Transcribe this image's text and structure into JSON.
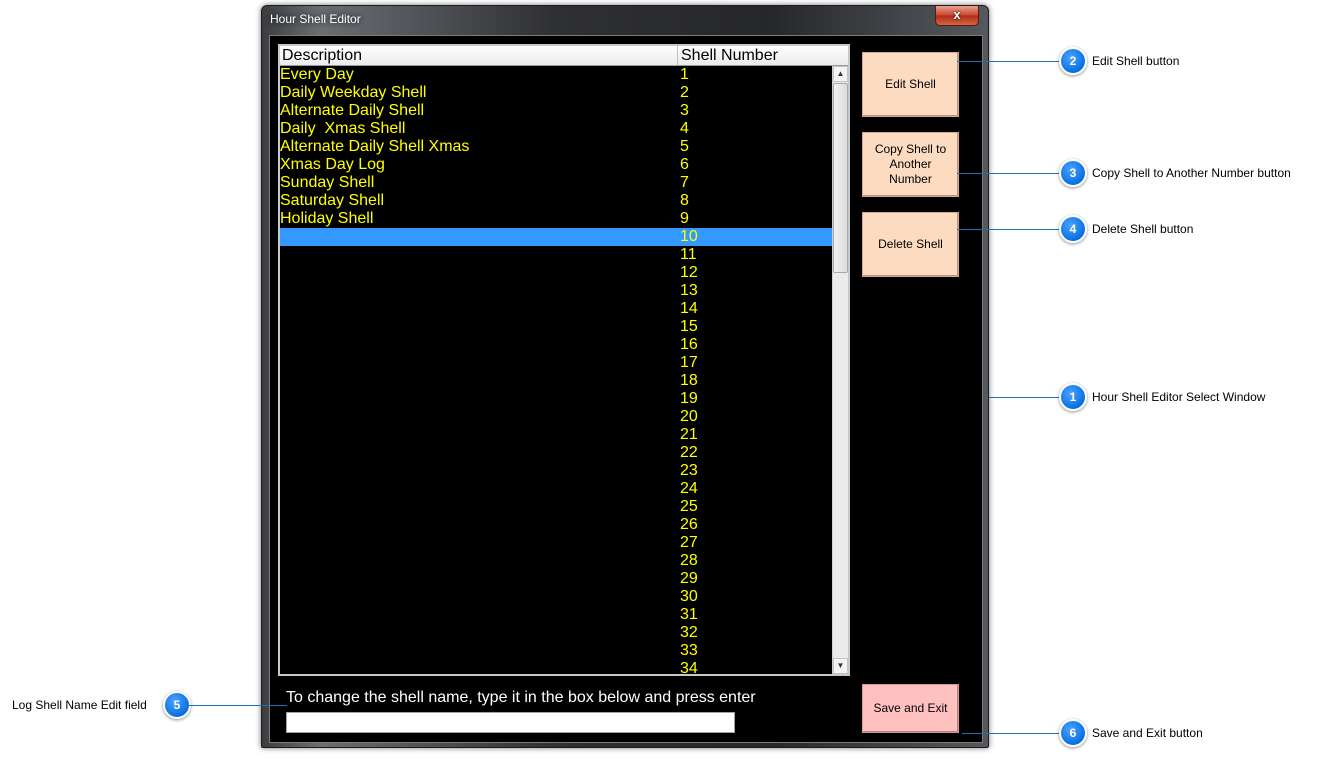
{
  "window": {
    "title": "Hour Shell Editor",
    "close_glyph": "x"
  },
  "list": {
    "columns": [
      "Description",
      "Shell Number"
    ],
    "selected_number": "10",
    "rows": [
      {
        "description": "Every Day",
        "number": "1"
      },
      {
        "description": "Daily Weekday Shell",
        "number": "2"
      },
      {
        "description": "Alternate Daily Shell",
        "number": "3"
      },
      {
        "description": "Daily  Xmas Shell",
        "number": "4"
      },
      {
        "description": "Alternate Daily Shell Xmas",
        "number": "5"
      },
      {
        "description": "Xmas Day Log",
        "number": "6"
      },
      {
        "description": "Sunday Shell",
        "number": "7"
      },
      {
        "description": "Saturday Shell",
        "number": "8"
      },
      {
        "description": "Holiday Shell",
        "number": "9"
      },
      {
        "description": "",
        "number": "10"
      },
      {
        "description": "",
        "number": "11"
      },
      {
        "description": "",
        "number": "12"
      },
      {
        "description": "",
        "number": "13"
      },
      {
        "description": "",
        "number": "14"
      },
      {
        "description": "",
        "number": "15"
      },
      {
        "description": "",
        "number": "16"
      },
      {
        "description": "",
        "number": "17"
      },
      {
        "description": "",
        "number": "18"
      },
      {
        "description": "",
        "number": "19"
      },
      {
        "description": "",
        "number": "20"
      },
      {
        "description": "",
        "number": "21"
      },
      {
        "description": "",
        "number": "22"
      },
      {
        "description": "",
        "number": "23"
      },
      {
        "description": "",
        "number": "24"
      },
      {
        "description": "",
        "number": "25"
      },
      {
        "description": "",
        "number": "26"
      },
      {
        "description": "",
        "number": "27"
      },
      {
        "description": "",
        "number": "28"
      },
      {
        "description": "",
        "number": "29"
      },
      {
        "description": "",
        "number": "30"
      },
      {
        "description": "",
        "number": "31"
      },
      {
        "description": "",
        "number": "32"
      },
      {
        "description": "",
        "number": "33"
      },
      {
        "description": "",
        "number": "34"
      }
    ]
  },
  "buttons": {
    "edit": "Edit Shell",
    "copy": "Copy Shell to Another Number",
    "delete": "Delete Shell",
    "save_exit": "Save and Exit"
  },
  "name_edit": {
    "hint": "To change the shell name, type it in the box below and press enter",
    "value": ""
  },
  "callouts": [
    {
      "number": "1",
      "label": "Hour Shell Editor Select Window"
    },
    {
      "number": "2",
      "label": "Edit Shell button"
    },
    {
      "number": "3",
      "label": "Copy Shell to Another Number button"
    },
    {
      "number": "4",
      "label": "Delete Shell button"
    },
    {
      "number": "5",
      "label": "Log Shell Name Edit field"
    },
    {
      "number": "6",
      "label": "Save and Exit button"
    }
  ],
  "colors": {
    "list_background": "#000000",
    "list_text": "#ffff00",
    "selection": "#3399ff",
    "button_face": "#fddbc0",
    "exit_button_face": "#ffc0c0",
    "callout_blue": "#0a6fe0"
  }
}
